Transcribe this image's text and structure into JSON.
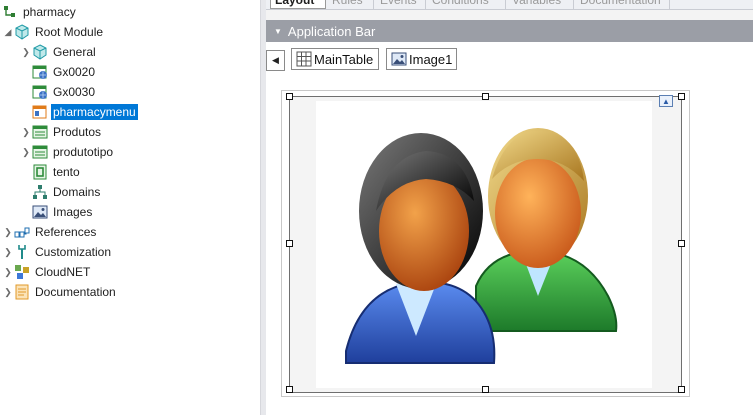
{
  "tree": {
    "root_label": "pharmacy",
    "items": [
      {
        "label": "Root Module",
        "icon": "module-icon",
        "expanded": true
      },
      {
        "label": "General",
        "icon": "module-icon"
      },
      {
        "label": "Gx0020",
        "icon": "webpanel-icon"
      },
      {
        "label": "Gx0030",
        "icon": "webpanel-icon"
      },
      {
        "label": "pharmacymenu",
        "icon": "menu-webpanel-icon",
        "selected": true
      },
      {
        "label": "Produtos",
        "icon": "transaction-icon"
      },
      {
        "label": "produtotipo",
        "icon": "transaction-icon"
      },
      {
        "label": "tento",
        "icon": "procedure-icon"
      },
      {
        "label": "Domains",
        "icon": "domains-icon"
      },
      {
        "label": "Images",
        "icon": "images-icon"
      },
      {
        "label": "References",
        "icon": "references-icon"
      },
      {
        "label": "Customization",
        "icon": "customization-icon"
      },
      {
        "label": "CloudNET",
        "icon": "cloudnet-icon"
      },
      {
        "label": "Documentation",
        "icon": "documentation-icon"
      }
    ]
  },
  "designer": {
    "tabs": [
      "Layout",
      "Rules",
      "Events",
      "Conditions",
      "Variables",
      "Documentation"
    ],
    "active_tab": "Layout",
    "app_bar_title": "Application Bar",
    "breadcrumb": [
      "MainTable",
      "Image1"
    ],
    "image_description_icon": "users-icon"
  },
  "colors": {
    "selection": "#0078d7",
    "app_bar": "#9b9ea6",
    "splitter": "#e7e8ec"
  }
}
